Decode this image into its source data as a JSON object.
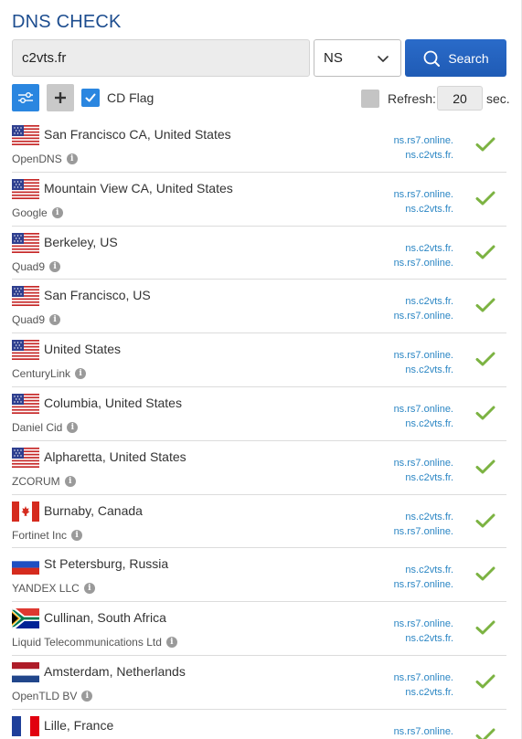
{
  "header": {
    "title": "DNS CHECK"
  },
  "search": {
    "domain_value": "c2vts.fr",
    "record_type": "NS",
    "search_label": "Search"
  },
  "options": {
    "cd_flag_label": "CD Flag",
    "cd_flag_checked": true,
    "refresh_label": "Refresh:",
    "refresh_checked": false,
    "refresh_value": "20",
    "refresh_unit": "sec."
  },
  "icons": {
    "settings": "sliders-icon",
    "add": "plus-icon",
    "search": "search-icon",
    "info": "info-icon",
    "status": "check-icon",
    "select": "chevron-down-icon"
  },
  "colors": {
    "title": "#1d4d8f",
    "primary": "#2a86e0",
    "search_button": "#1f5bb5",
    "ns_link": "#2b86c4",
    "check": "#7cb342"
  },
  "results": [
    {
      "flag": "us",
      "location": "San Francisco CA, United States",
      "provider": "OpenDNS",
      "ns": [
        "ns.rs7.online.",
        "ns.c2vts.fr."
      ],
      "status": "ok"
    },
    {
      "flag": "us",
      "location": "Mountain View CA, United States",
      "provider": "Google",
      "ns": [
        "ns.rs7.online.",
        "ns.c2vts.fr."
      ],
      "status": "ok"
    },
    {
      "flag": "us",
      "location": "Berkeley, US",
      "provider": "Quad9",
      "ns": [
        "ns.c2vts.fr.",
        "ns.rs7.online."
      ],
      "status": "ok"
    },
    {
      "flag": "us",
      "location": "San Francisco, US",
      "provider": "Quad9",
      "ns": [
        "ns.c2vts.fr.",
        "ns.rs7.online."
      ],
      "status": "ok"
    },
    {
      "flag": "us",
      "location": "United States",
      "provider": "CenturyLink",
      "ns": [
        "ns.rs7.online.",
        "ns.c2vts.fr."
      ],
      "status": "ok"
    },
    {
      "flag": "us",
      "location": "Columbia, United States",
      "provider": "Daniel Cid",
      "ns": [
        "ns.rs7.online.",
        "ns.c2vts.fr."
      ],
      "status": "ok"
    },
    {
      "flag": "us",
      "location": "Alpharetta, United States",
      "provider": "ZCORUM",
      "ns": [
        "ns.rs7.online.",
        "ns.c2vts.fr."
      ],
      "status": "ok"
    },
    {
      "flag": "ca",
      "location": "Burnaby, Canada",
      "provider": "Fortinet Inc",
      "ns": [
        "ns.c2vts.fr.",
        "ns.rs7.online."
      ],
      "status": "ok"
    },
    {
      "flag": "ru",
      "location": "St Petersburg, Russia",
      "provider": "YANDEX LLC",
      "ns": [
        "ns.c2vts.fr.",
        "ns.rs7.online."
      ],
      "status": "ok"
    },
    {
      "flag": "za",
      "location": "Cullinan, South Africa",
      "provider": "Liquid Telecommunications Ltd",
      "ns": [
        "ns.rs7.online.",
        "ns.c2vts.fr."
      ],
      "status": "ok"
    },
    {
      "flag": "nl",
      "location": "Amsterdam, Netherlands",
      "provider": "OpenTLD BV",
      "ns": [
        "ns.rs7.online.",
        "ns.c2vts.fr."
      ],
      "status": "ok"
    },
    {
      "flag": "fr",
      "location": "Lille, France",
      "provider": "",
      "ns": [
        "ns.rs7.online."
      ],
      "status": "ok"
    }
  ]
}
